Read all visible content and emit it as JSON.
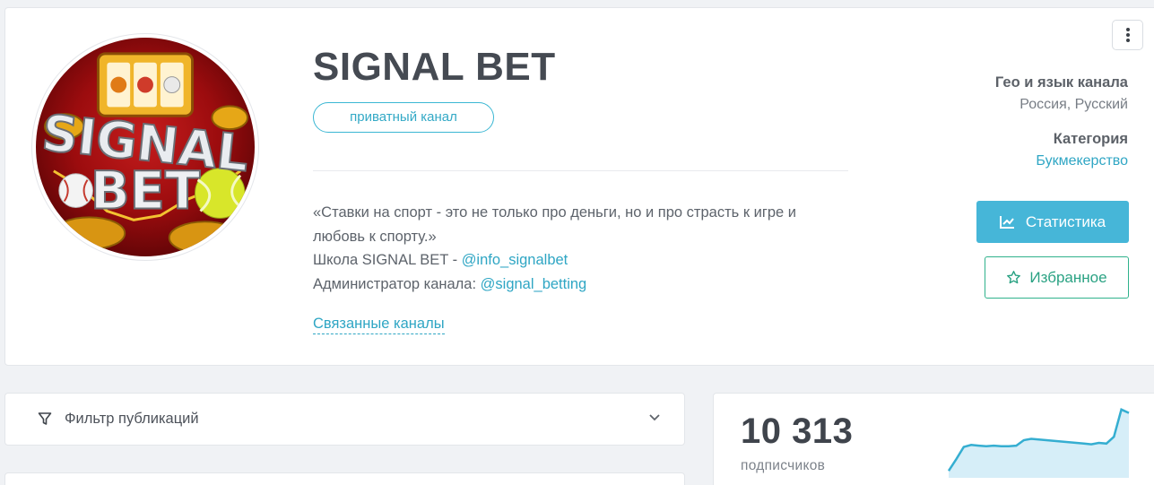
{
  "channel": {
    "title": "SIGNAL BET",
    "badge": "приватный канал",
    "avatar_text_top": "SIGNAL",
    "avatar_text_bottom": "BET",
    "description": {
      "line1": "«Ставки на спорт - это не только про деньги, но и про страсть к игре и",
      "line2": "любовь к спорту.»",
      "school_prefix": "Школа SIGNAL BET - ",
      "school_link": "@info_signalbet",
      "admin_prefix": "Администратор канала: ",
      "admin_link": "@signal_betting"
    },
    "related_label": "Связанные каналы"
  },
  "sidebar": {
    "geo_heading": "Гео и язык канала",
    "geo_value": "Россия, Русский",
    "category_heading": "Категория",
    "category_value": "Букмекерство",
    "stats_button": "Статистика",
    "favorite_button": "Избранное"
  },
  "filter": {
    "label": "Фильтр публикаций"
  },
  "subscribers": {
    "count": "10 313",
    "label": "подписчиков",
    "trend": [
      0.05,
      0.22,
      0.4,
      0.43,
      0.42,
      0.41,
      0.42,
      0.41,
      0.41,
      0.42,
      0.5,
      0.52,
      0.51,
      0.5,
      0.49,
      0.48,
      0.47,
      0.46,
      0.45,
      0.44,
      0.46,
      0.45,
      0.55,
      0.95,
      0.9
    ]
  },
  "colors": {
    "accent": "#46b6d8",
    "link": "#2fa6c4",
    "favorite": "#2fb28c",
    "background": "#f0f2f5"
  }
}
